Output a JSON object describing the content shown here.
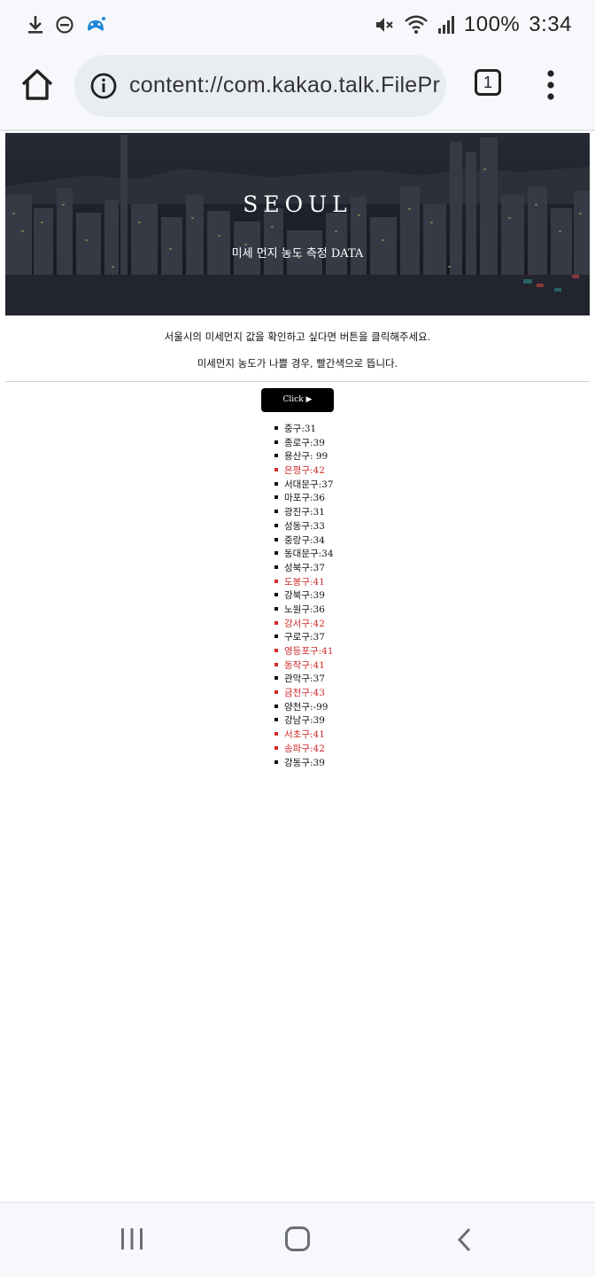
{
  "status_bar": {
    "battery": "100%",
    "time": "3:34",
    "left_icons": [
      "download-icon",
      "do-not-disturb-icon",
      "game-controller-icon"
    ],
    "right_icons": [
      "mute-icon",
      "wifi-icon",
      "signal-icon"
    ]
  },
  "browser": {
    "url": "content://com.kakao.talk.FilePr",
    "tab_count": "1"
  },
  "hero": {
    "title": "SEOUL",
    "subtitle": "미세 먼지 농도 측정 DATA"
  },
  "intro": {
    "line1": "서울시의 미세먼지 값을 확인하고 싶다면 버튼을 클릭해주세요.",
    "line2": "미세먼지 농도가 나쁠 경우, 빨간색으로 뜹니다."
  },
  "click_button": {
    "label": "Click ▶"
  },
  "districts": [
    {
      "text": "중구:31",
      "bad": false
    },
    {
      "text": "종로구:39",
      "bad": false
    },
    {
      "text": "용산구: 99",
      "bad": false
    },
    {
      "text": "은평구:42",
      "bad": true
    },
    {
      "text": "서대문구:37",
      "bad": false
    },
    {
      "text": "마포구:36",
      "bad": false
    },
    {
      "text": "광진구:31",
      "bad": false
    },
    {
      "text": "성동구:33",
      "bad": false
    },
    {
      "text": "중랑구:34",
      "bad": false
    },
    {
      "text": "동대문구:34",
      "bad": false
    },
    {
      "text": "성북구:37",
      "bad": false
    },
    {
      "text": "도봉구:41",
      "bad": true
    },
    {
      "text": "강북구:39",
      "bad": false
    },
    {
      "text": "노원구:36",
      "bad": false
    },
    {
      "text": "강서구:42",
      "bad": true
    },
    {
      "text": "구로구:37",
      "bad": false
    },
    {
      "text": "영등포구:41",
      "bad": true
    },
    {
      "text": "동작구:41",
      "bad": true
    },
    {
      "text": "관악구:37",
      "bad": false
    },
    {
      "text": "금천구:43",
      "bad": true
    },
    {
      "text": "양천구:-99",
      "bad": false
    },
    {
      "text": "강남구:39",
      "bad": false
    },
    {
      "text": "서초구:41",
      "bad": true
    },
    {
      "text": "송파구:42",
      "bad": true
    },
    {
      "text": "강동구:39",
      "bad": false
    }
  ],
  "colors": {
    "bad": "#d12a2a",
    "normal": "#111111",
    "button_bg": "#000000"
  }
}
